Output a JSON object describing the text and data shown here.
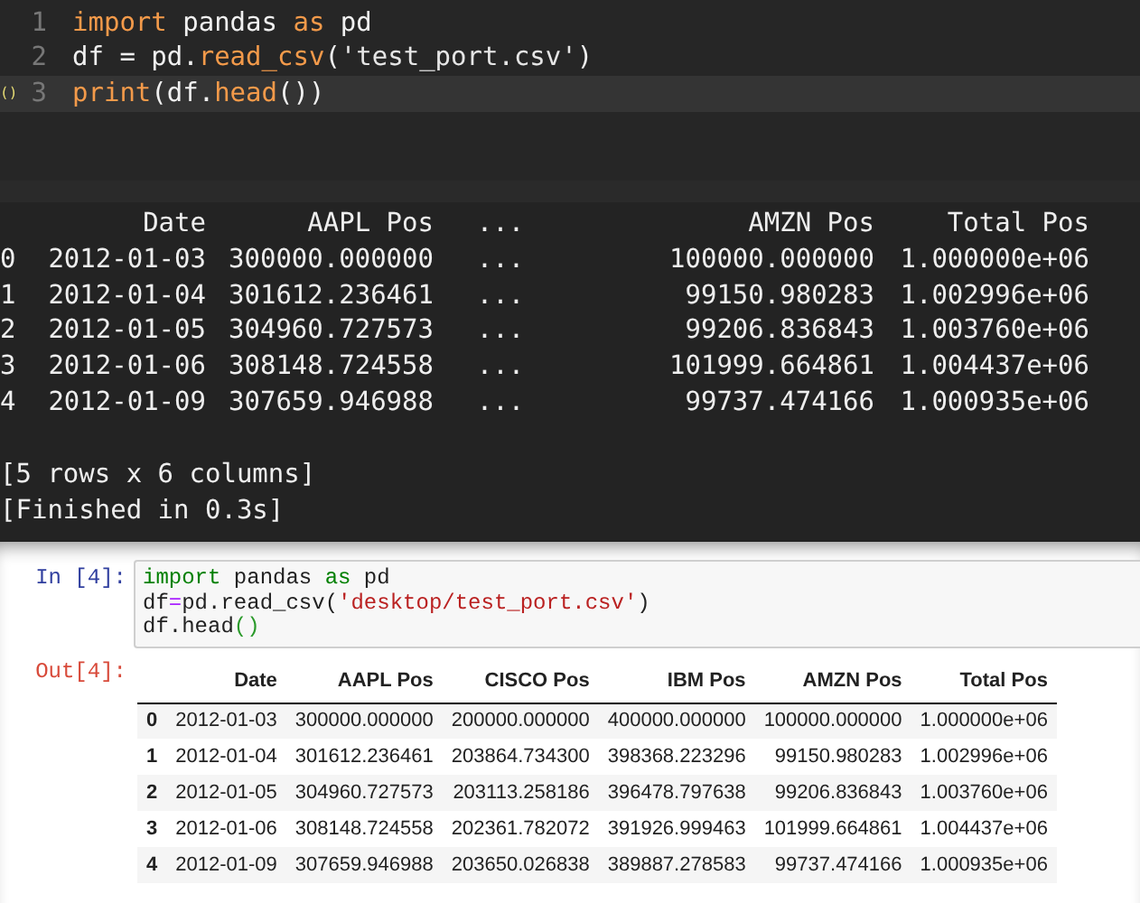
{
  "editor": {
    "lines": [
      {
        "number": "1",
        "current": false,
        "tokens": [
          {
            "kind": "keyword",
            "text": "import"
          },
          {
            "kind": "plain",
            "text": " pandas "
          },
          {
            "kind": "keyword",
            "text": "as"
          },
          {
            "kind": "plain",
            "text": " pd"
          }
        ]
      },
      {
        "number": "2",
        "current": false,
        "tokens": [
          {
            "kind": "plain",
            "text": "df = pd."
          },
          {
            "kind": "func",
            "text": "read_csv"
          },
          {
            "kind": "plain",
            "text": "("
          },
          {
            "kind": "string",
            "text": "'test_port.csv'"
          },
          {
            "kind": "plain",
            "text": ")"
          }
        ]
      },
      {
        "number": "3",
        "current": true,
        "marker": "()",
        "tokens": [
          {
            "kind": "func",
            "text": "print"
          },
          {
            "kind": "plain",
            "text": "(df."
          },
          {
            "kind": "func",
            "text": "head"
          },
          {
            "kind": "plain",
            "text": "())"
          }
        ]
      }
    ]
  },
  "console": {
    "columns": [
      "",
      "Date",
      "AAPL Pos",
      "...",
      "AMZN Pos",
      "Total Pos"
    ],
    "rows": [
      [
        "0",
        "2012-01-03",
        "300000.000000",
        "...",
        "100000.000000",
        "1.000000e+06"
      ],
      [
        "1",
        "2012-01-04",
        "301612.236461",
        "...",
        "99150.980283",
        "1.002996e+06"
      ],
      [
        "2",
        "2012-01-05",
        "304960.727573",
        "...",
        "99206.836843",
        "1.003760e+06"
      ],
      [
        "3",
        "2012-01-06",
        "308148.724558",
        "...",
        "101999.664861",
        "1.004437e+06"
      ],
      [
        "4",
        "2012-01-09",
        "307659.946988",
        "...",
        "99737.474166",
        "1.000935e+06"
      ]
    ],
    "summary": "[5 rows x 6 columns]",
    "status": "[Finished in 0.3s]"
  },
  "notebook": {
    "input_prompt": "In [4]:",
    "code_lines": [
      [
        {
          "kind": "keyword",
          "text": "import"
        },
        {
          "kind": "plain",
          "text": " pandas "
        },
        {
          "kind": "keyword",
          "text": "as"
        },
        {
          "kind": "plain",
          "text": " pd"
        }
      ],
      [
        {
          "kind": "plain",
          "text": "df"
        },
        {
          "kind": "operator",
          "text": "="
        },
        {
          "kind": "plain",
          "text": "pd.read_csv("
        },
        {
          "kind": "string",
          "text": "'desktop/test_port.csv'"
        },
        {
          "kind": "plain",
          "text": ")"
        }
      ],
      [
        {
          "kind": "plain",
          "text": "df.head"
        },
        {
          "kind": "paren",
          "text": "()"
        }
      ]
    ],
    "output_prompt": "Out[4]:",
    "table": {
      "columns": [
        "",
        "Date",
        "AAPL Pos",
        "CISCO Pos",
        "IBM Pos",
        "AMZN Pos",
        "Total Pos"
      ],
      "rows": [
        [
          "0",
          "2012-01-03",
          "300000.000000",
          "200000.000000",
          "400000.000000",
          "100000.000000",
          "1.000000e+06"
        ],
        [
          "1",
          "2012-01-04",
          "301612.236461",
          "203864.734300",
          "398368.223296",
          "99150.980283",
          "1.002996e+06"
        ],
        [
          "2",
          "2012-01-05",
          "304960.727573",
          "203113.258186",
          "396478.797638",
          "99206.836843",
          "1.003760e+06"
        ],
        [
          "3",
          "2012-01-06",
          "308148.724558",
          "202361.782072",
          "391926.999463",
          "101999.664861",
          "1.004437e+06"
        ],
        [
          "4",
          "2012-01-09",
          "307659.946988",
          "203650.026838",
          "389887.278583",
          "99737.474166",
          "1.000935e+06"
        ]
      ]
    }
  }
}
